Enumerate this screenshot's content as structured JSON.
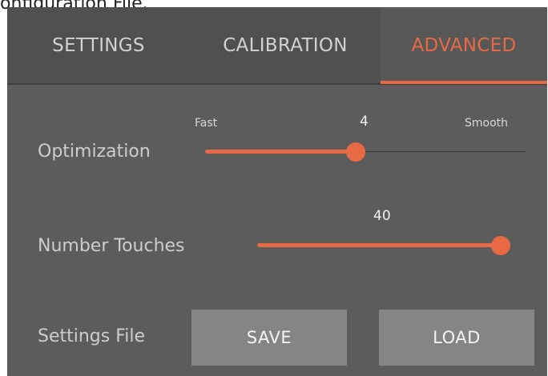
{
  "caption": "onfiguration File.",
  "tabs": [
    {
      "label": "SETTINGS"
    },
    {
      "label": "CALIBRATION"
    },
    {
      "label": "ADVANCED"
    }
  ],
  "active_tab": "ADVANCED",
  "accent_color": "#e86a45",
  "optimization": {
    "label": "Optimization",
    "min_label": "Fast",
    "max_label": "Smooth",
    "value": "4",
    "fraction": 0.47
  },
  "number_touches": {
    "label": "Number Touches",
    "value": "40",
    "fraction": 1.0
  },
  "settings_file": {
    "label": "Settings File",
    "save_label": "SAVE",
    "load_label": "LOAD"
  }
}
